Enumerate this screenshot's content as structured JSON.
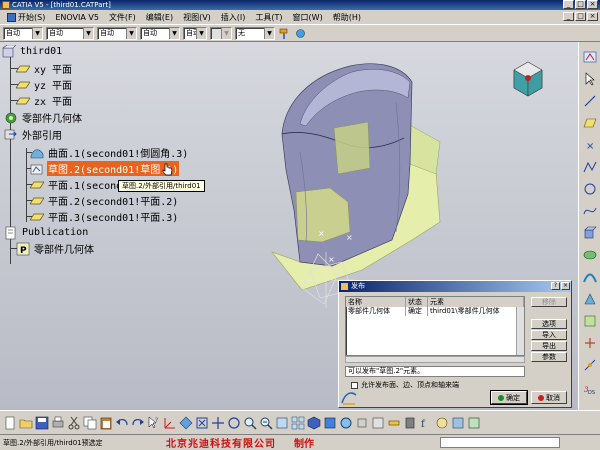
{
  "window": {
    "title": "CATIA V5 - [third01.CATPart]"
  },
  "menu": {
    "items": [
      "开始(S)",
      "ENOVIA V5",
      "文件(F)",
      "编辑(E)",
      "视图(V)",
      "插入(I)",
      "工具(T)",
      "窗口(W)",
      "帮助(H)"
    ]
  },
  "toolbar": {
    "dropdowns": [
      "自动",
      "自动",
      "自动",
      "自动",
      "自动",
      "无"
    ]
  },
  "tree": {
    "root": "third01",
    "xy": "xy 平面",
    "yz": "yz 平面",
    "zx": "zx 平面",
    "part_body": "零部件几何体",
    "external": "外部引用",
    "surface": "曲面.1(second01!倒圆角.3)",
    "sketch": "草图.2(second01!草图.1)",
    "plane1": "平面.1(second01!平面.1)",
    "plane2": "平面.2(second01!平面.2)",
    "plane3": "平面.3(second01!平面.3)",
    "publication": "Publication",
    "pub_body": "零部件几何体"
  },
  "tooltip": "草图.2/外部引用/third01",
  "dialog": {
    "title": "发布",
    "columns": [
      "名称",
      "状态",
      "元素"
    ],
    "row": [
      "零部件几何体",
      "确定",
      "third01\\零部件几何体"
    ],
    "buttons": {
      "edit": "移除",
      "options": "选项",
      "import": "导入",
      "export": "导出",
      "params": "参数"
    },
    "info": "可以发布\"草图.2\"元素。",
    "checkbox": "允许发布面、边、顶点和轴来端",
    "ok": "确定",
    "cancel": "取消"
  },
  "status": {
    "text": "草图.2/外部引用/third01预选定",
    "company": "北京兆迪科技有限公司",
    "company_suffix": "制作"
  },
  "colors": {
    "selection": "#e8641c",
    "part_body": "#8e8fb4",
    "surface": "#e6eeac"
  }
}
